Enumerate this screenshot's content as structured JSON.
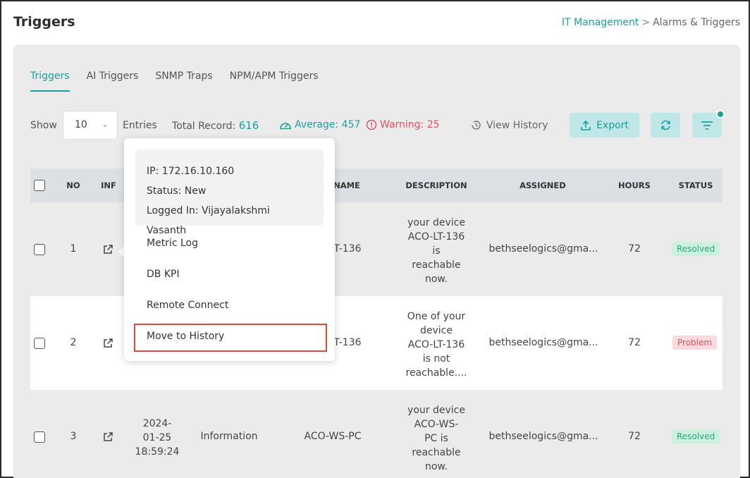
{
  "page": {
    "title": "Triggers",
    "breadcrumb": {
      "parent": "IT Management",
      "separator": ">",
      "current": "Alarms & Triggers"
    }
  },
  "tabs": [
    {
      "label": "Triggers",
      "active": true
    },
    {
      "label": "AI Triggers",
      "active": false
    },
    {
      "label": "SNMP Traps",
      "active": false
    },
    {
      "label": "NPM/APM Triggers",
      "active": false
    }
  ],
  "toolbar": {
    "show_label": "Show",
    "entries_value": "10",
    "entries_label": "Entries",
    "total_label": "Total Record:",
    "total_value": "616",
    "average_label": "Average: 457",
    "warning_label": "Warning: 25",
    "view_history_label": "View History",
    "export_label": "Export"
  },
  "table": {
    "headers": {
      "no": "NO",
      "info": "INF",
      "name": "NAME",
      "description": "DESCRIPTION",
      "assigned": "ASSIGNED",
      "hours": "HOURS",
      "status": "STATUS"
    },
    "rows": [
      {
        "no": "1",
        "date": "",
        "time": "",
        "severity": "",
        "name": "T-136",
        "description": [
          "your device",
          "ACO-LT-136",
          "is",
          "reachable",
          "now."
        ],
        "assigned": "bethseelogics@gma...",
        "hours": "72",
        "status": "Resolved"
      },
      {
        "no": "2",
        "date": "",
        "time": "",
        "severity": "",
        "name": "T-136",
        "description": [
          "One of your",
          "device",
          "ACO-LT-136",
          "is not",
          "reachable...."
        ],
        "assigned": "bethseelogics@gma...",
        "hours": "72",
        "status": "Problem"
      },
      {
        "no": "3",
        "date": "2024-",
        "date2": "01-25",
        "time": "18:59:24",
        "severity": "Information",
        "name": "ACO-WS-PC",
        "description": [
          "your device",
          "ACO-WS-",
          "PC is",
          "reachable",
          "now."
        ],
        "assigned": "bethseelogics@gma...",
        "hours": "72",
        "status": "Resolved"
      }
    ]
  },
  "popup": {
    "ip": "IP: 172.16.10.160",
    "status": "Status: New",
    "logged_in": "Logged In: Vijayalakshmi Vasanth",
    "menu": {
      "metric_log": "Metric Log",
      "db_kpi": "DB KPI",
      "remote_connect": "Remote Connect",
      "move_to_history": "Move to History"
    }
  },
  "colors": {
    "accent": "#1a9e9e",
    "warning": "#e0505a",
    "resolved": "#2fa66f",
    "highlight_border": "#d9473f"
  }
}
